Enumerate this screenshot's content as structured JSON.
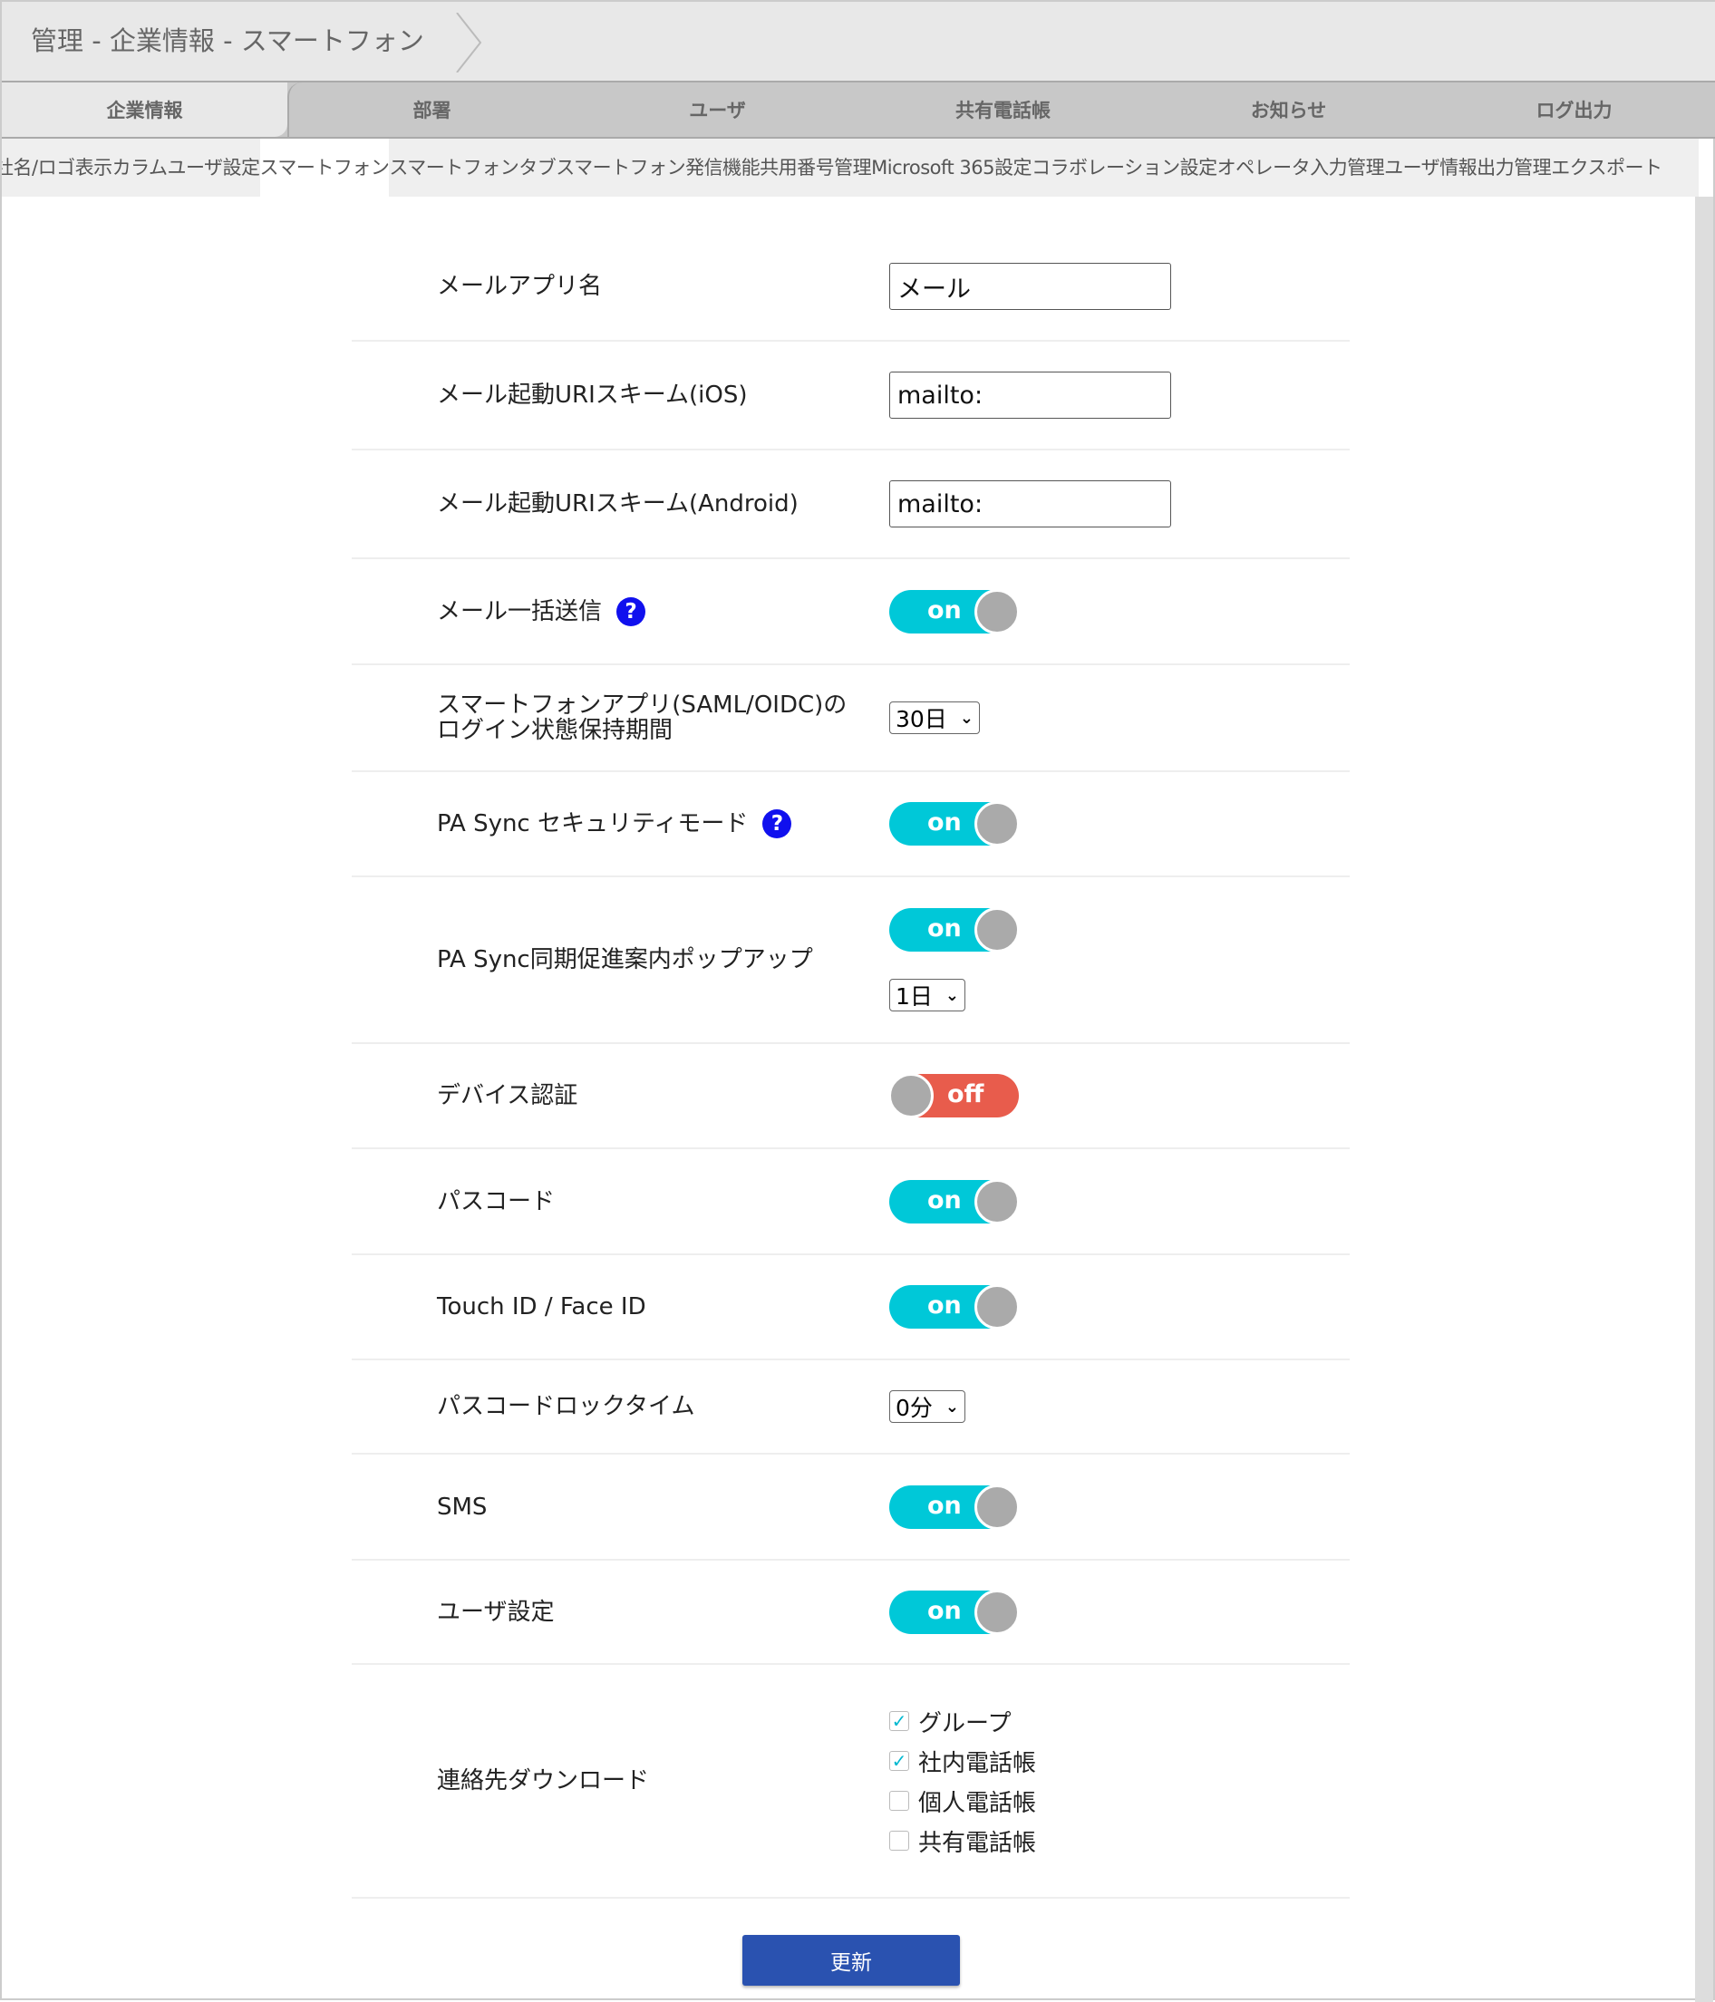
{
  "header": {
    "title": "管理 - 企業情報 - スマートフォン"
  },
  "tabs": [
    "企業情報",
    "部署",
    "ユーザ",
    "共有電話帳",
    "お知らせ",
    "ログ出力"
  ],
  "subtabs": [
    "社名/ロゴ表示",
    "カラム",
    "ユーザ設定",
    "スマートフォン",
    "スマートフォンタブ",
    "スマートフォン発信機能",
    "共用番号管理",
    "Microsoft 365設定",
    "コラボレーション設定",
    "オペレータ入力管理",
    "ユーザ情報出力管理",
    "エクスポート"
  ],
  "rows": {
    "mail_app": {
      "label": "メールアプリ名",
      "value": "メール"
    },
    "uri_ios": {
      "label": "メール起動URIスキーム(iOS)",
      "value": "mailto:"
    },
    "uri_android": {
      "label": "メール起動URIスキーム(Android)",
      "value": "mailto:"
    },
    "bulk_mail": {
      "label": "メール一括送信",
      "state": "on"
    },
    "login_keep": {
      "label1": "スマートフォンアプリ(SAML/OIDC)の",
      "label2": "ログイン状態保持期間",
      "value": "30日"
    },
    "pa_security": {
      "label": "PA Sync セキュリティモード",
      "state": "on"
    },
    "pa_popup": {
      "label": "PA Sync同期促進案内ポップアップ",
      "state": "on",
      "value": "1日"
    },
    "device_auth": {
      "label": "デバイス認証",
      "state": "off"
    },
    "passcode": {
      "label": "パスコード",
      "state": "on"
    },
    "touch_id": {
      "label": "Touch ID / Face ID",
      "state": "on"
    },
    "lock_time": {
      "label": "パスコードロックタイム",
      "value": "0分"
    },
    "sms": {
      "label": "SMS",
      "state": "on"
    },
    "user_setting": {
      "label": "ユーザ設定",
      "state": "on"
    },
    "contacts": {
      "label": "連絡先ダウンロード",
      "options": [
        {
          "label": "グループ",
          "checked": true
        },
        {
          "label": "社内電話帳",
          "checked": true
        },
        {
          "label": "個人電話帳",
          "checked": false
        },
        {
          "label": "共有電話帳",
          "checked": false
        }
      ]
    }
  },
  "help_glyph": "?",
  "check_glyph": "✓",
  "caret_glyph": "⌄",
  "submit_label": "更新",
  "colors": {
    "on": "#00c8d8",
    "off": "#e85c4c",
    "help": "#1010ee",
    "button": "#2a52b0"
  }
}
